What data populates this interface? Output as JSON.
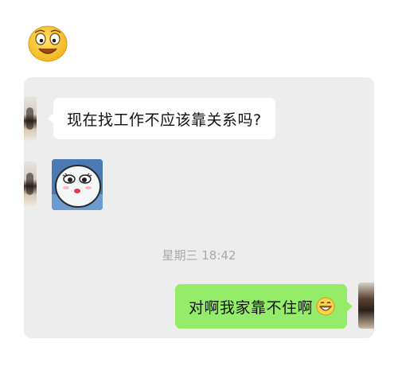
{
  "top_emoji": {
    "icon": "smiling-face-emoji-icon"
  },
  "chat": {
    "messages": [
      {
        "side": "left",
        "type": "text",
        "text": "现在找工作不应该靠关系吗?"
      },
      {
        "side": "left",
        "type": "sticker",
        "icon": "cute-ghost-sticker-icon"
      },
      {
        "type": "timestamp",
        "text": "星期三 18:42"
      },
      {
        "side": "right",
        "type": "text",
        "text": "对啊我家靠不住啊",
        "trailing_icon": "grinning-face-emoji-icon"
      }
    ]
  },
  "colors": {
    "panel_background": "#ededed",
    "incoming_bubble": "#ffffff",
    "outgoing_bubble": "#95ec69",
    "timestamp_text": "#a8a8a8"
  }
}
